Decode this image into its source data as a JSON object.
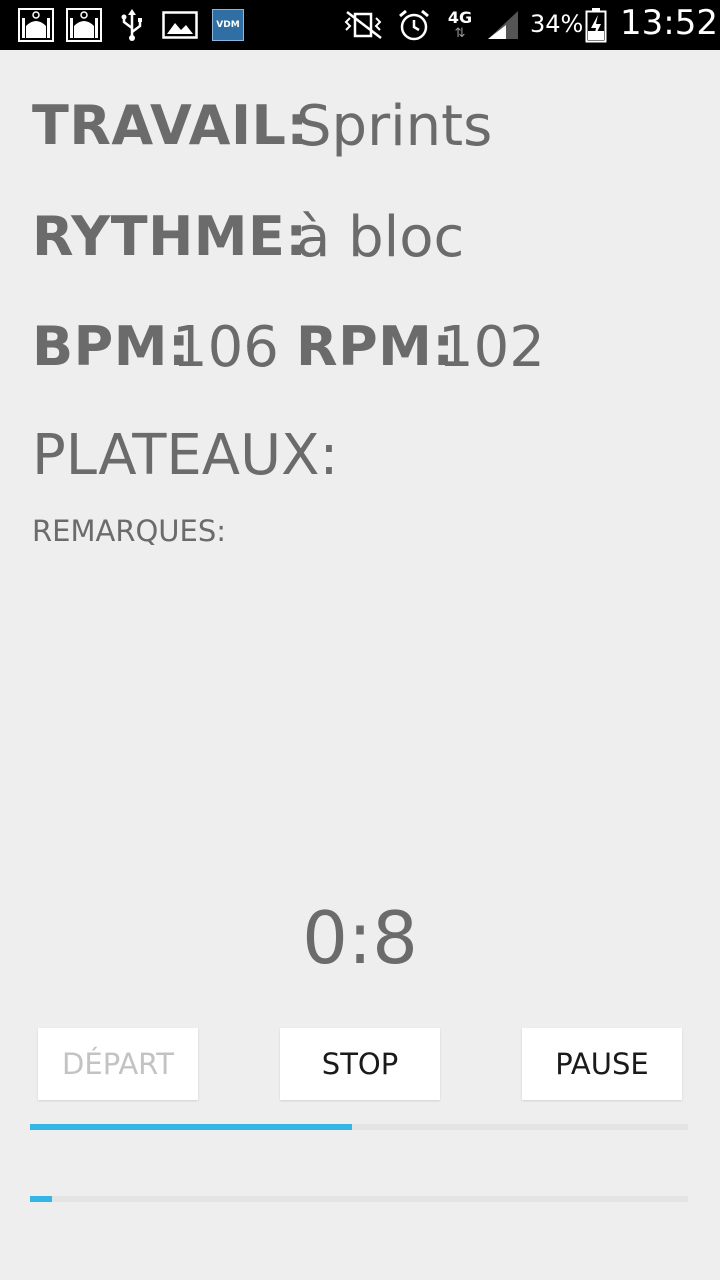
{
  "statusbar": {
    "network": "4G",
    "battery": "34%",
    "time": "13:52",
    "vdm_label": "VDM",
    "icons": [
      "mosque-icon",
      "mosque-icon",
      "usb-icon",
      "image-icon",
      "vdm-app-icon",
      "vibrate-icon",
      "alarm-icon",
      "network-4g-icon",
      "signal-icon",
      "battery-charging-icon"
    ]
  },
  "workout": {
    "travail_label": "TRAVAIL:",
    "travail_value": "Sprints",
    "rythme_label": "RYTHME:",
    "rythme_value": "à bloc",
    "bpm_label": "BPM:",
    "bpm_value": "106",
    "rpm_label": "RPM:",
    "rpm_value": "102",
    "plateaux_label": "PLATEAUX:",
    "remarques_label": "REMARQUES:"
  },
  "timer": {
    "value": "0:8"
  },
  "buttons": {
    "depart": "DÉPART",
    "stop": "STOP",
    "pause": "PAUSE"
  },
  "progress": {
    "primary_fraction": 0.49,
    "secondary_fraction": 0.033,
    "accent_color": "#33b5e5"
  }
}
